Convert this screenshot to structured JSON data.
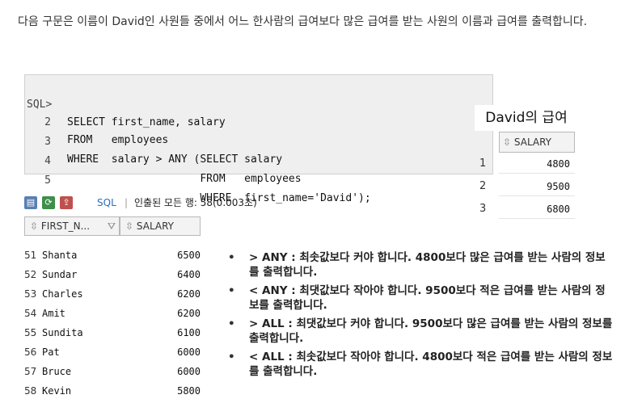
{
  "intro": "다음 구문은 이름이 David인 사원들 중에서 어느 한사람의 급여보다 많은 급여를 받는 사원의 이름과 급여를 출력합니다.",
  "sql": {
    "prompt": "SQL>",
    "lines": [
      {
        "num": "",
        "code": "SELECT first_name, salary"
      },
      {
        "num": "2",
        "code": "FROM   employees"
      },
      {
        "num": "3",
        "code": "WHERE  salary > ANY (SELECT salary"
      },
      {
        "num": "4",
        "code": "                     FROM   employees"
      },
      {
        "num": "5",
        "code": "                     WHERE  first_name='David');"
      }
    ]
  },
  "david": {
    "caption": "David의 급여",
    "column": "SALARY",
    "rows": [
      {
        "num": "1",
        "salary": "4800"
      },
      {
        "num": "2",
        "salary": "9500"
      },
      {
        "num": "3",
        "salary": "6800"
      }
    ]
  },
  "toolbar": {
    "sql_label": "SQL",
    "separator": "|",
    "status": "인출된 모든 행: 58(0.003초)",
    "icons": [
      "pin-icon",
      "refresh-icon",
      "export-icon"
    ]
  },
  "results": {
    "columns": [
      "FIRST_N...",
      "SALARY"
    ],
    "rows": [
      {
        "num": "51",
        "name": "Shanta",
        "salary": "6500"
      },
      {
        "num": "52",
        "name": "Sundar",
        "salary": "6400"
      },
      {
        "num": "53",
        "name": "Charles",
        "salary": "6200"
      },
      {
        "num": "54",
        "name": "Amit",
        "salary": "6200"
      },
      {
        "num": "55",
        "name": "Sundita",
        "salary": "6100"
      },
      {
        "num": "56",
        "name": "Pat",
        "salary": "6000"
      },
      {
        "num": "57",
        "name": "Bruce",
        "salary": "6000"
      },
      {
        "num": "58",
        "name": "Kevin",
        "salary": "5800"
      }
    ]
  },
  "notes": [
    "> ANY : 최솟값보다 커야 합니다. 4800보다 많은 급여를 받는 사람의 정보를 출력합니다.",
    "< ANY : 최댓값보다 작아야 합니다. 9500보다 적은 급여를 받는 사람의 정보를 출력합니다.",
    "> ALL : 최댓값보다 커야 합니다. 9500보다 많은 급여를 받는 사람의 정보를 출력합니다.",
    "< ALL : 최솟값보다 작아야 합니다. 4800보다 적은 급여를 받는 사람의 정보를 출력합니다."
  ],
  "colors": {
    "sql_background": "#efefef",
    "grid_header": "#f3f3f3",
    "sql_link": "#2a6ebb"
  }
}
